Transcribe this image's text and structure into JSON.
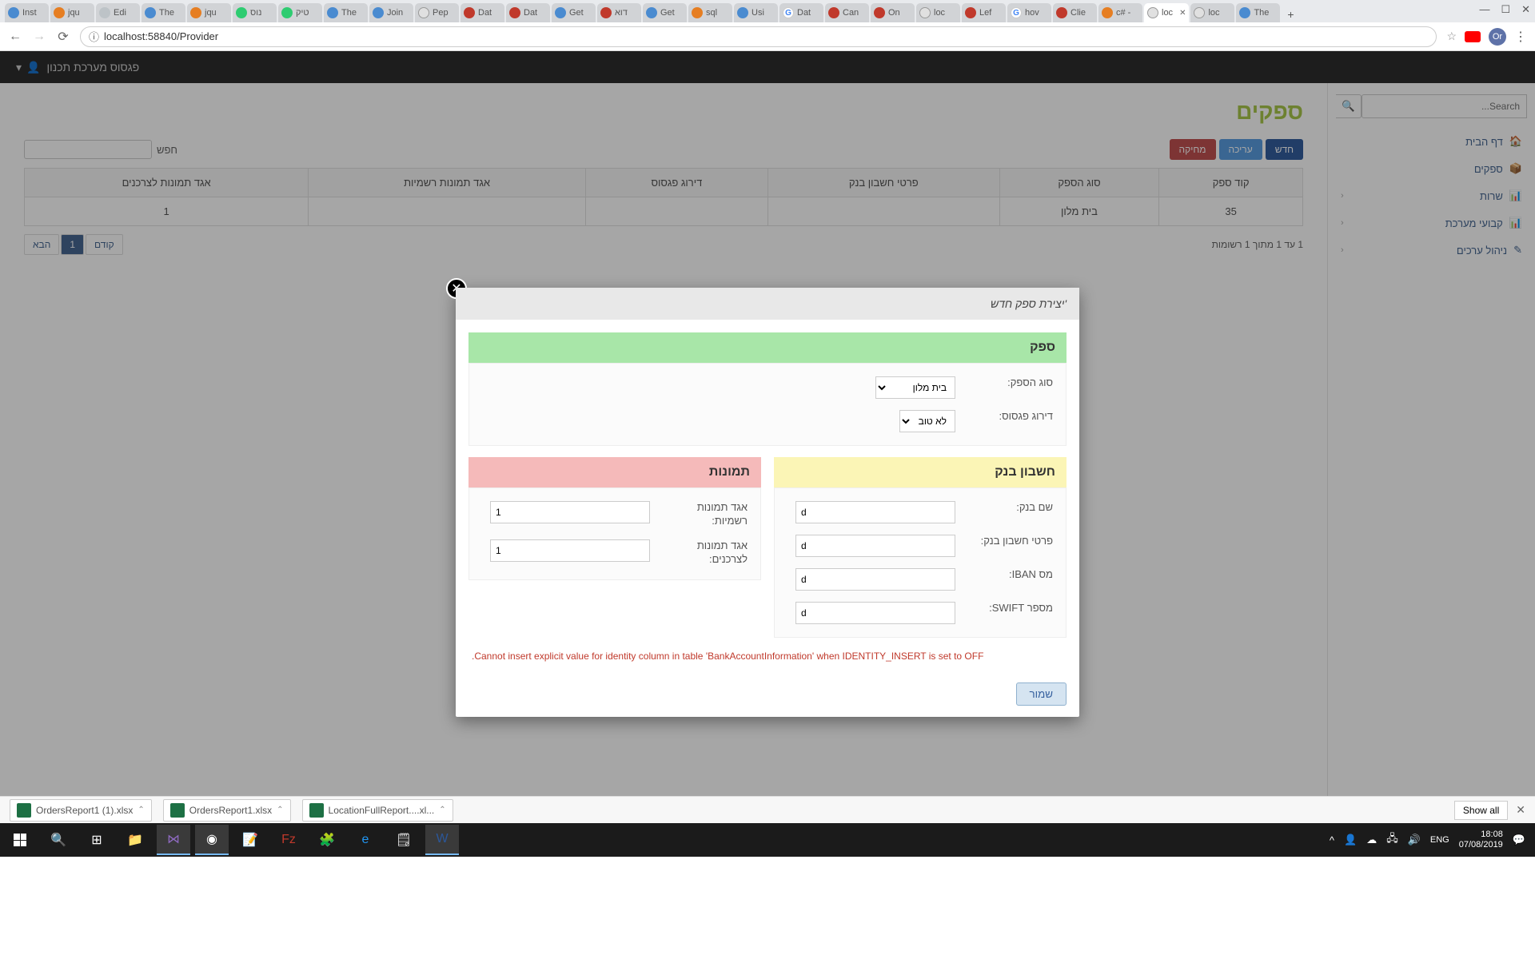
{
  "browser": {
    "tabs": [
      {
        "label": "Inst"
      },
      {
        "label": "jqu"
      },
      {
        "label": "Edi"
      },
      {
        "label": "The"
      },
      {
        "label": "jqu"
      },
      {
        "label": "נוס"
      },
      {
        "label": "טיק"
      },
      {
        "label": "The"
      },
      {
        "label": "Join"
      },
      {
        "label": "Pep"
      },
      {
        "label": "Dat"
      },
      {
        "label": "Dat"
      },
      {
        "label": "Get"
      },
      {
        "label": "דוא"
      },
      {
        "label": "Get"
      },
      {
        "label": "sql"
      },
      {
        "label": "Usi"
      },
      {
        "label": "Dat"
      },
      {
        "label": "Can"
      },
      {
        "label": "On"
      },
      {
        "label": "loc"
      },
      {
        "label": "Lef"
      },
      {
        "label": "hov"
      },
      {
        "label": "Clie"
      },
      {
        "label": "c# -"
      },
      {
        "label": "loc"
      },
      {
        "label": "loc"
      },
      {
        "label": "The"
      }
    ],
    "active_tab_index": 25,
    "url_prefix": "ⓘ",
    "url": "localhost:58840/Provider"
  },
  "app": {
    "navbar_title": "פגסוס מערכת תכנון",
    "search_placeholder": "Search...",
    "nav": {
      "home": "דף הבית",
      "providers": "ספקים",
      "service": "שרות",
      "system_constants": "קבועי מערכת",
      "value_management": "ניהול ערכים"
    },
    "page_title": "ספקים",
    "buttons": {
      "new": "חדש",
      "edit": "עריכה",
      "delete": "מחיקה"
    },
    "search_label": "חפש",
    "table": {
      "headers": {
        "code": "קוד ספק",
        "provider_type": "סוג הספק",
        "bank_details": "פרטי חשבון בנק",
        "pegasus_rating": "דירוג פגסוס",
        "official_photos": "אגד תמונות רשמיות",
        "consumer_photos": "אגד תמונות לצרכנים"
      },
      "rows": [
        {
          "code": "35",
          "provider_type": "בית מלון",
          "consumer_photos": "1"
        }
      ]
    },
    "info_text": "1 עד 1 מתוך 1 רשומות",
    "pager": {
      "prev": "קודם",
      "page": "1",
      "next": "הבא"
    }
  },
  "modal": {
    "title": "'יצירת ספק חדש",
    "sections": {
      "provider": "ספק",
      "bank": "חשבון בנק",
      "photos": "תמונות"
    },
    "fields": {
      "provider_type_label": "סוג הספק:",
      "provider_type_value": "בית מלון",
      "pegasus_rating_label": "דירוג פגסוס:",
      "pegasus_rating_value": "לא טוב",
      "bank_name_label": "שם בנק:",
      "bank_name_value": "d",
      "bank_account_label": "פרטי חשבון בנק:",
      "bank_account_value": "d",
      "iban_label": "מס IBAN:",
      "iban_value": "d",
      "swift_label": "מספר SWIFT:",
      "swift_value": "d",
      "official_photos_label": "אגד תמונות רשמיות:",
      "official_photos_value": "1",
      "consumer_photos_label": "אגד תמונות לצרכנים:",
      "consumer_photos_value": "1"
    },
    "error": ".Cannot insert explicit value for identity column in table 'BankAccountInformation' when IDENTITY_INSERT is set to OFF",
    "save": "שמור"
  },
  "downloads": {
    "items": [
      {
        "name": "OrdersReport1 (1).xlsx"
      },
      {
        "name": "OrdersReport1.xlsx"
      },
      {
        "name": "LocationFullReport....xl..."
      }
    ],
    "show_all": "Show all"
  },
  "taskbar": {
    "lang": "ENG",
    "time": "18:08",
    "date": "07/08/2019"
  }
}
